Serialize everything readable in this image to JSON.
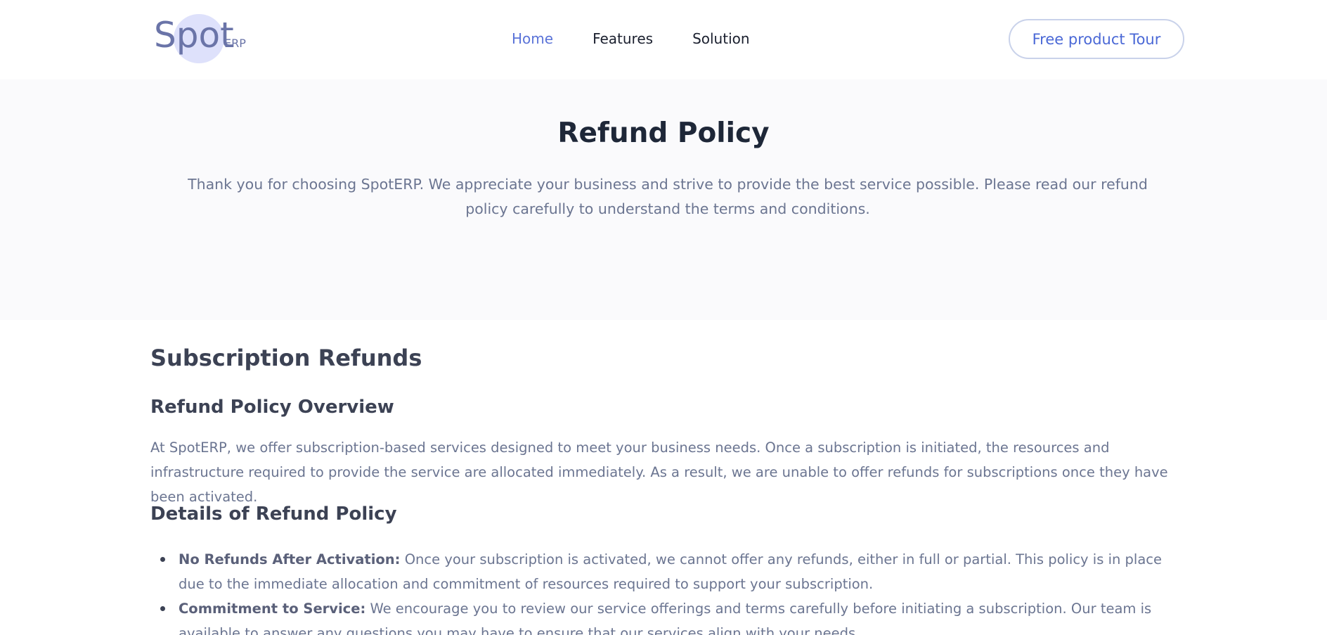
{
  "header": {
    "logo_text": "Spot",
    "logo_suffix": "ERP",
    "nav": [
      {
        "label": "Home",
        "active": true
      },
      {
        "label": "Features",
        "active": false
      },
      {
        "label": "Solution",
        "active": false
      }
    ],
    "cta_label": "Free product Tour"
  },
  "hero": {
    "title": "Refund Policy",
    "text": "Thank you for choosing SpotERP. We appreciate your business and strive to provide the best service possible. Please read our refund policy carefully to understand the terms and conditions."
  },
  "content": {
    "section_title": "Subscription Refunds",
    "overview_title": "Refund Policy Overview",
    "overview_text": "At SpotERP, we offer subscription-based services designed to meet your business needs. Once a subscription is initiated, the resources and infrastructure required to provide the service are allocated immediately. As a result, we are unable to offer refunds for subscriptions once they have been activated.",
    "details_title": "Details of Refund Policy",
    "details": [
      {
        "term": "No Refunds After Activation:",
        "text": " Once your subscription is activated, we cannot offer any refunds, either in full or partial. This policy is in place due to the immediate allocation and commitment of resources required to support your subscription."
      },
      {
        "term": "Commitment to Service:",
        "text": " We encourage you to review our service offerings and terms carefully before initiating a subscription. Our team is available to answer any questions you may have to ensure that our services align with your needs."
      }
    ]
  },
  "colors": {
    "accent": "#5a73d8",
    "logo_blob": "#dee1fb",
    "heading": "#1e2738",
    "body_text": "#6b7591"
  }
}
